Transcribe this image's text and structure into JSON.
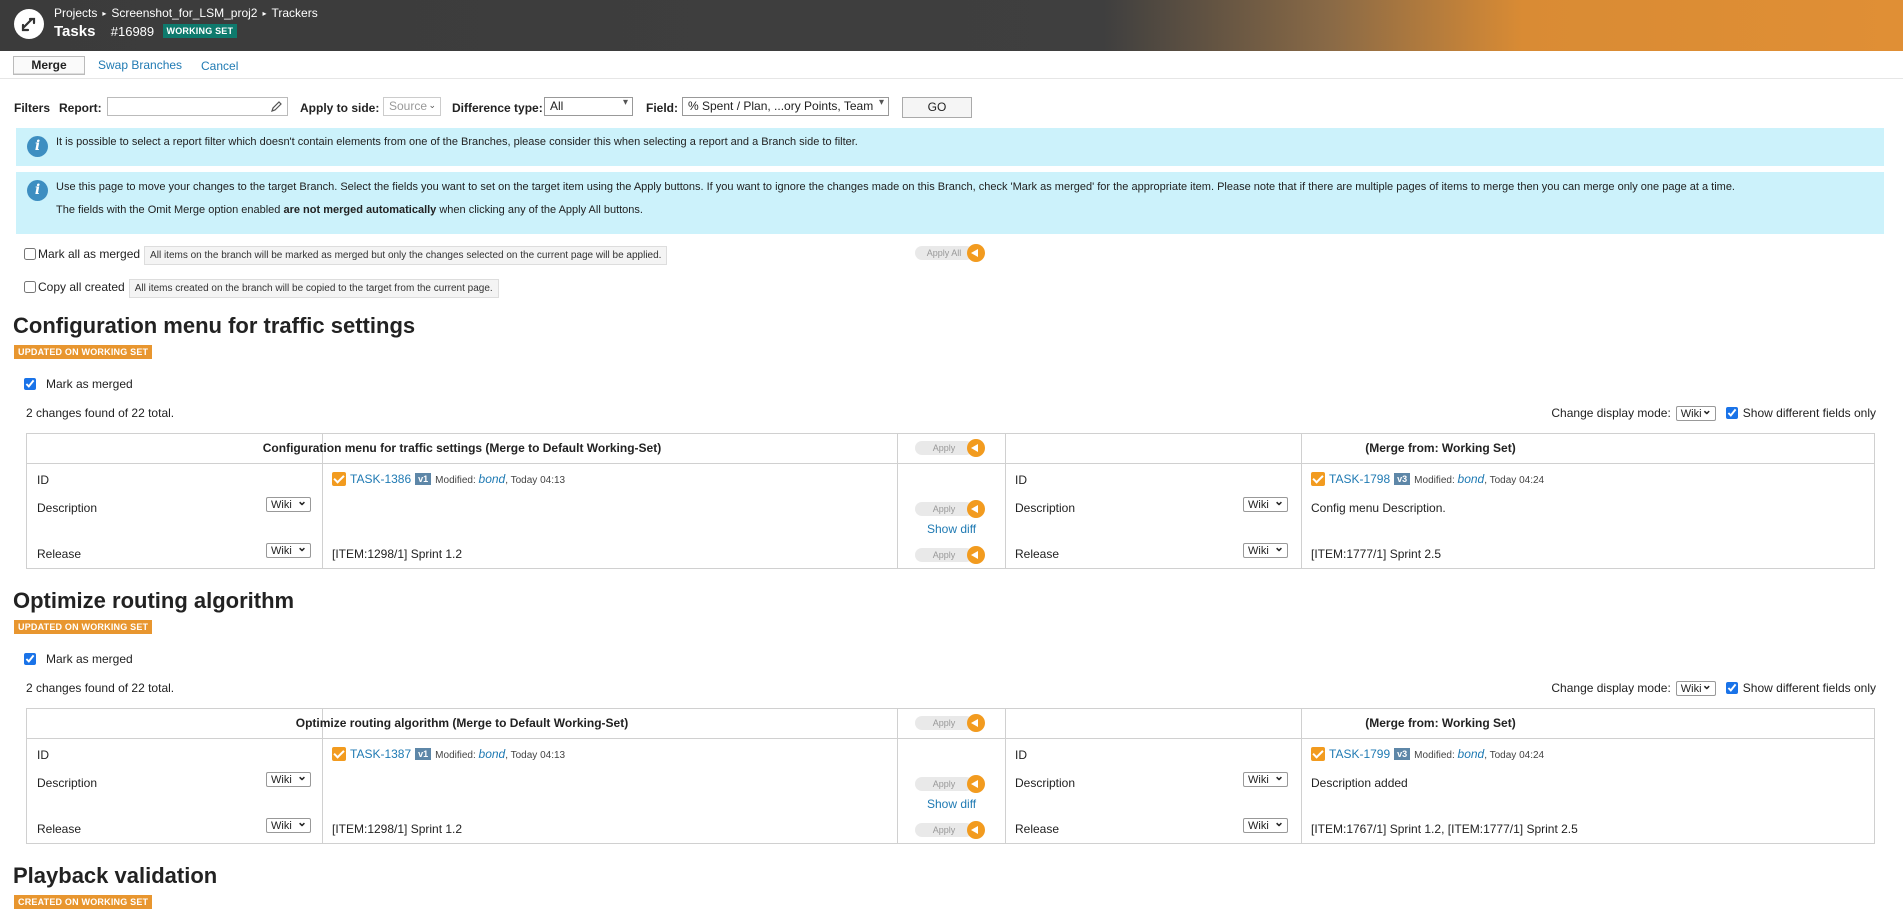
{
  "header": {
    "breadcrumbs": [
      "Projects",
      "Screenshot_for_LSM_proj2",
      "Trackers"
    ],
    "title": "Tasks",
    "id": "#16989",
    "badge": "WORKING SET"
  },
  "toolbar": {
    "merge_label": "Merge",
    "swap_label": "Swap Branches",
    "cancel_label": "Cancel"
  },
  "filters": {
    "label": "Filters",
    "report_label": "Report:",
    "report_value": "",
    "apply_side_label": "Apply to side:",
    "apply_side_value": "Source",
    "diff_type_label": "Difference type:",
    "diff_type_value": "All",
    "field_label": "Field:",
    "field_value": "% Spent / Plan, ...ory Points, Team",
    "go_label": "GO"
  },
  "info": {
    "msg1": "It is possible to select a report filter which doesn't contain elements from one of the Branches, please consider this when selecting a report and a Branch side to filter.",
    "msg2": "Use this page to move your changes to the target Branch. Select the fields you want to set on the target item using the Apply buttons. If you want to ignore the changes made on this Branch, check 'Mark as merged' for the appropriate item. Please note that if there are multiple pages of items to merge then you can merge only one page at a time.",
    "msg3_pre": "The fields with the Omit Merge option enabled ",
    "msg3_bold": "are not merged automatically",
    "msg3_post": " when clicking any of the Apply All buttons."
  },
  "mass": {
    "mark_all_label": "Mark all as merged",
    "mark_all_hint": "All items on the branch will be marked as merged but only the changes selected on the current page will be applied.",
    "copy_all_label": "Copy all created",
    "copy_all_hint": "All items created on the branch will be copied to the target from the current page.",
    "apply_all_label": "Apply All"
  },
  "common": {
    "mark_merged": "Mark as merged",
    "display_mode_label": "Change display mode:",
    "display_mode_value": "Wiki",
    "show_diff_only": "Show different fields only",
    "apply": "Apply",
    "show_diff": "Show diff",
    "merge_from": "(Merge from: Working Set)",
    "field_id": "ID",
    "field_description": "Description",
    "field_release": "Release",
    "wiki": "Wiki",
    "modified": "Modified:"
  },
  "sections": [
    {
      "title": "Configuration menu for traffic settings",
      "status": "UPDATED ON WORKING SET",
      "changes": "2 changes found of 22 total.",
      "target_header": "Configuration menu for traffic settings (Merge to Default Working-Set)",
      "left": {
        "task": "TASK-1386",
        "version": "v1",
        "user": "bond",
        "time": ", Today 04:13",
        "description": "",
        "release": "[ITEM:1298/1] Sprint 1.2"
      },
      "right": {
        "task": "TASK-1798",
        "version": "v3",
        "user": "bond",
        "time": ", Today 04:24",
        "description": "Config menu Description.",
        "release": "[ITEM:1777/1] Sprint 2.5"
      }
    },
    {
      "title": "Optimize routing algorithm",
      "status": "UPDATED ON WORKING SET",
      "changes": "2 changes found of 22 total.",
      "target_header": "Optimize routing algorithm (Merge to Default Working-Set)",
      "left": {
        "task": "TASK-1387",
        "version": "v1",
        "user": "bond",
        "time": ", Today 04:13",
        "description": "",
        "release": "[ITEM:1298/1] Sprint 1.2"
      },
      "right": {
        "task": "TASK-1799",
        "version": "v3",
        "user": "bond",
        "time": ", Today 04:24",
        "description": "Description added",
        "release": "[ITEM:1767/1] Sprint 1.2, [ITEM:1777/1] Sprint 2.5"
      }
    },
    {
      "title": "Playback validation",
      "status": "CREATED ON WORKING SET"
    }
  ],
  "colors": {
    "accent": "#e8962f",
    "link": "#1f7ab3",
    "info_bg": "#ccf2fb",
    "badge_teal": "#0e7a6d"
  }
}
